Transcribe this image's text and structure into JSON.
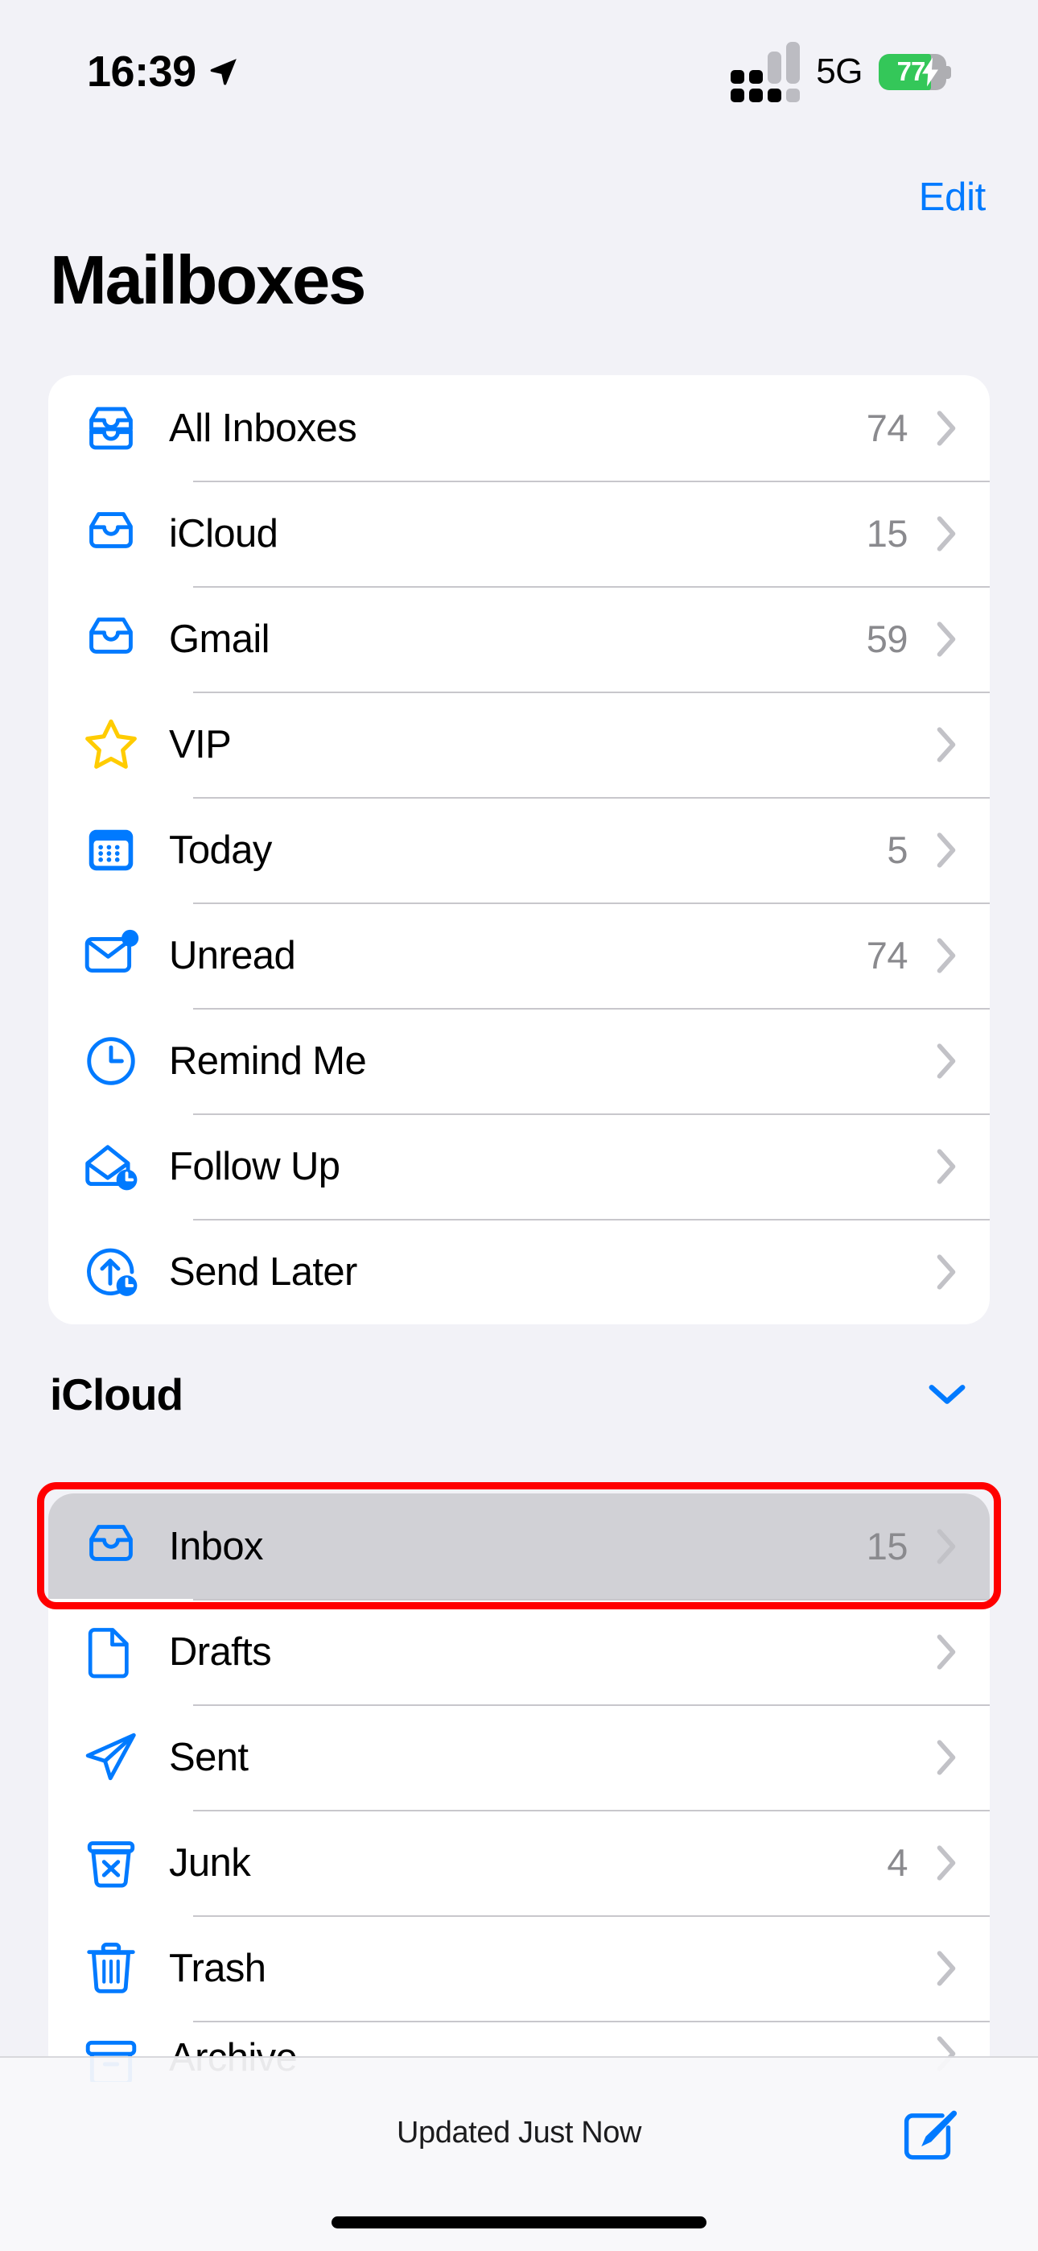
{
  "status_bar": {
    "time": "16:39",
    "location_icon": "location-arrow-icon",
    "signal_icon": "cellular-signal-icon",
    "network": "5G",
    "battery_percent": "77",
    "battery_level": 77,
    "battery_charging": true,
    "battery_color": "#34C759"
  },
  "nav": {
    "edit_label": "Edit",
    "accent_color": "#007AFF"
  },
  "header": {
    "title": "Mailboxes"
  },
  "main_list": [
    {
      "icon": "all-inboxes-tray-icon",
      "label": "All Inboxes",
      "count": "74",
      "chevron": "chevron-right-icon"
    },
    {
      "icon": "inbox-tray-icon",
      "label": "iCloud",
      "count": "15",
      "chevron": "chevron-right-icon"
    },
    {
      "icon": "inbox-tray-icon",
      "label": "Gmail",
      "count": "59",
      "chevron": "chevron-right-icon"
    },
    {
      "icon": "star-icon",
      "label": "VIP",
      "count": "",
      "chevron": "chevron-right-icon"
    },
    {
      "icon": "calendar-icon",
      "label": "Today",
      "count": "5",
      "chevron": "chevron-right-icon"
    },
    {
      "icon": "envelope-badge-icon",
      "label": "Unread",
      "count": "74",
      "chevron": "chevron-right-icon"
    },
    {
      "icon": "clock-icon",
      "label": "Remind Me",
      "count": "",
      "chevron": "chevron-right-icon"
    },
    {
      "icon": "open-envelope-clock-icon",
      "label": "Follow Up",
      "count": "",
      "chevron": "chevron-right-icon"
    },
    {
      "icon": "send-later-icon",
      "label": "Send Later",
      "count": "",
      "chevron": "chevron-right-icon"
    }
  ],
  "icloud_section": {
    "title": "iCloud",
    "collapse_icon": "chevron-down-icon",
    "items": [
      {
        "icon": "inbox-tray-icon",
        "label": "Inbox",
        "count": "15",
        "chevron": "chevron-right-icon",
        "selected": true
      },
      {
        "icon": "drafts-doc-icon",
        "label": "Drafts",
        "count": "",
        "chevron": "chevron-right-icon",
        "selected": false
      },
      {
        "icon": "paper-plane-icon",
        "label": "Sent",
        "count": "",
        "chevron": "chevron-right-icon",
        "selected": false
      },
      {
        "icon": "junk-bin-x-icon",
        "label": "Junk",
        "count": "4",
        "chevron": "chevron-right-icon",
        "selected": false
      },
      {
        "icon": "trash-icon",
        "label": "Trash",
        "count": "",
        "chevron": "chevron-right-icon",
        "selected": false
      },
      {
        "icon": "archive-box-icon",
        "label": "Archive",
        "count": "",
        "chevron": "chevron-right-icon",
        "selected": false
      }
    ]
  },
  "highlight": {
    "target_label": "Inbox",
    "color": "#FF0000"
  },
  "toolbar": {
    "status_text": "Updated Just Now",
    "compose_icon": "compose-icon"
  }
}
